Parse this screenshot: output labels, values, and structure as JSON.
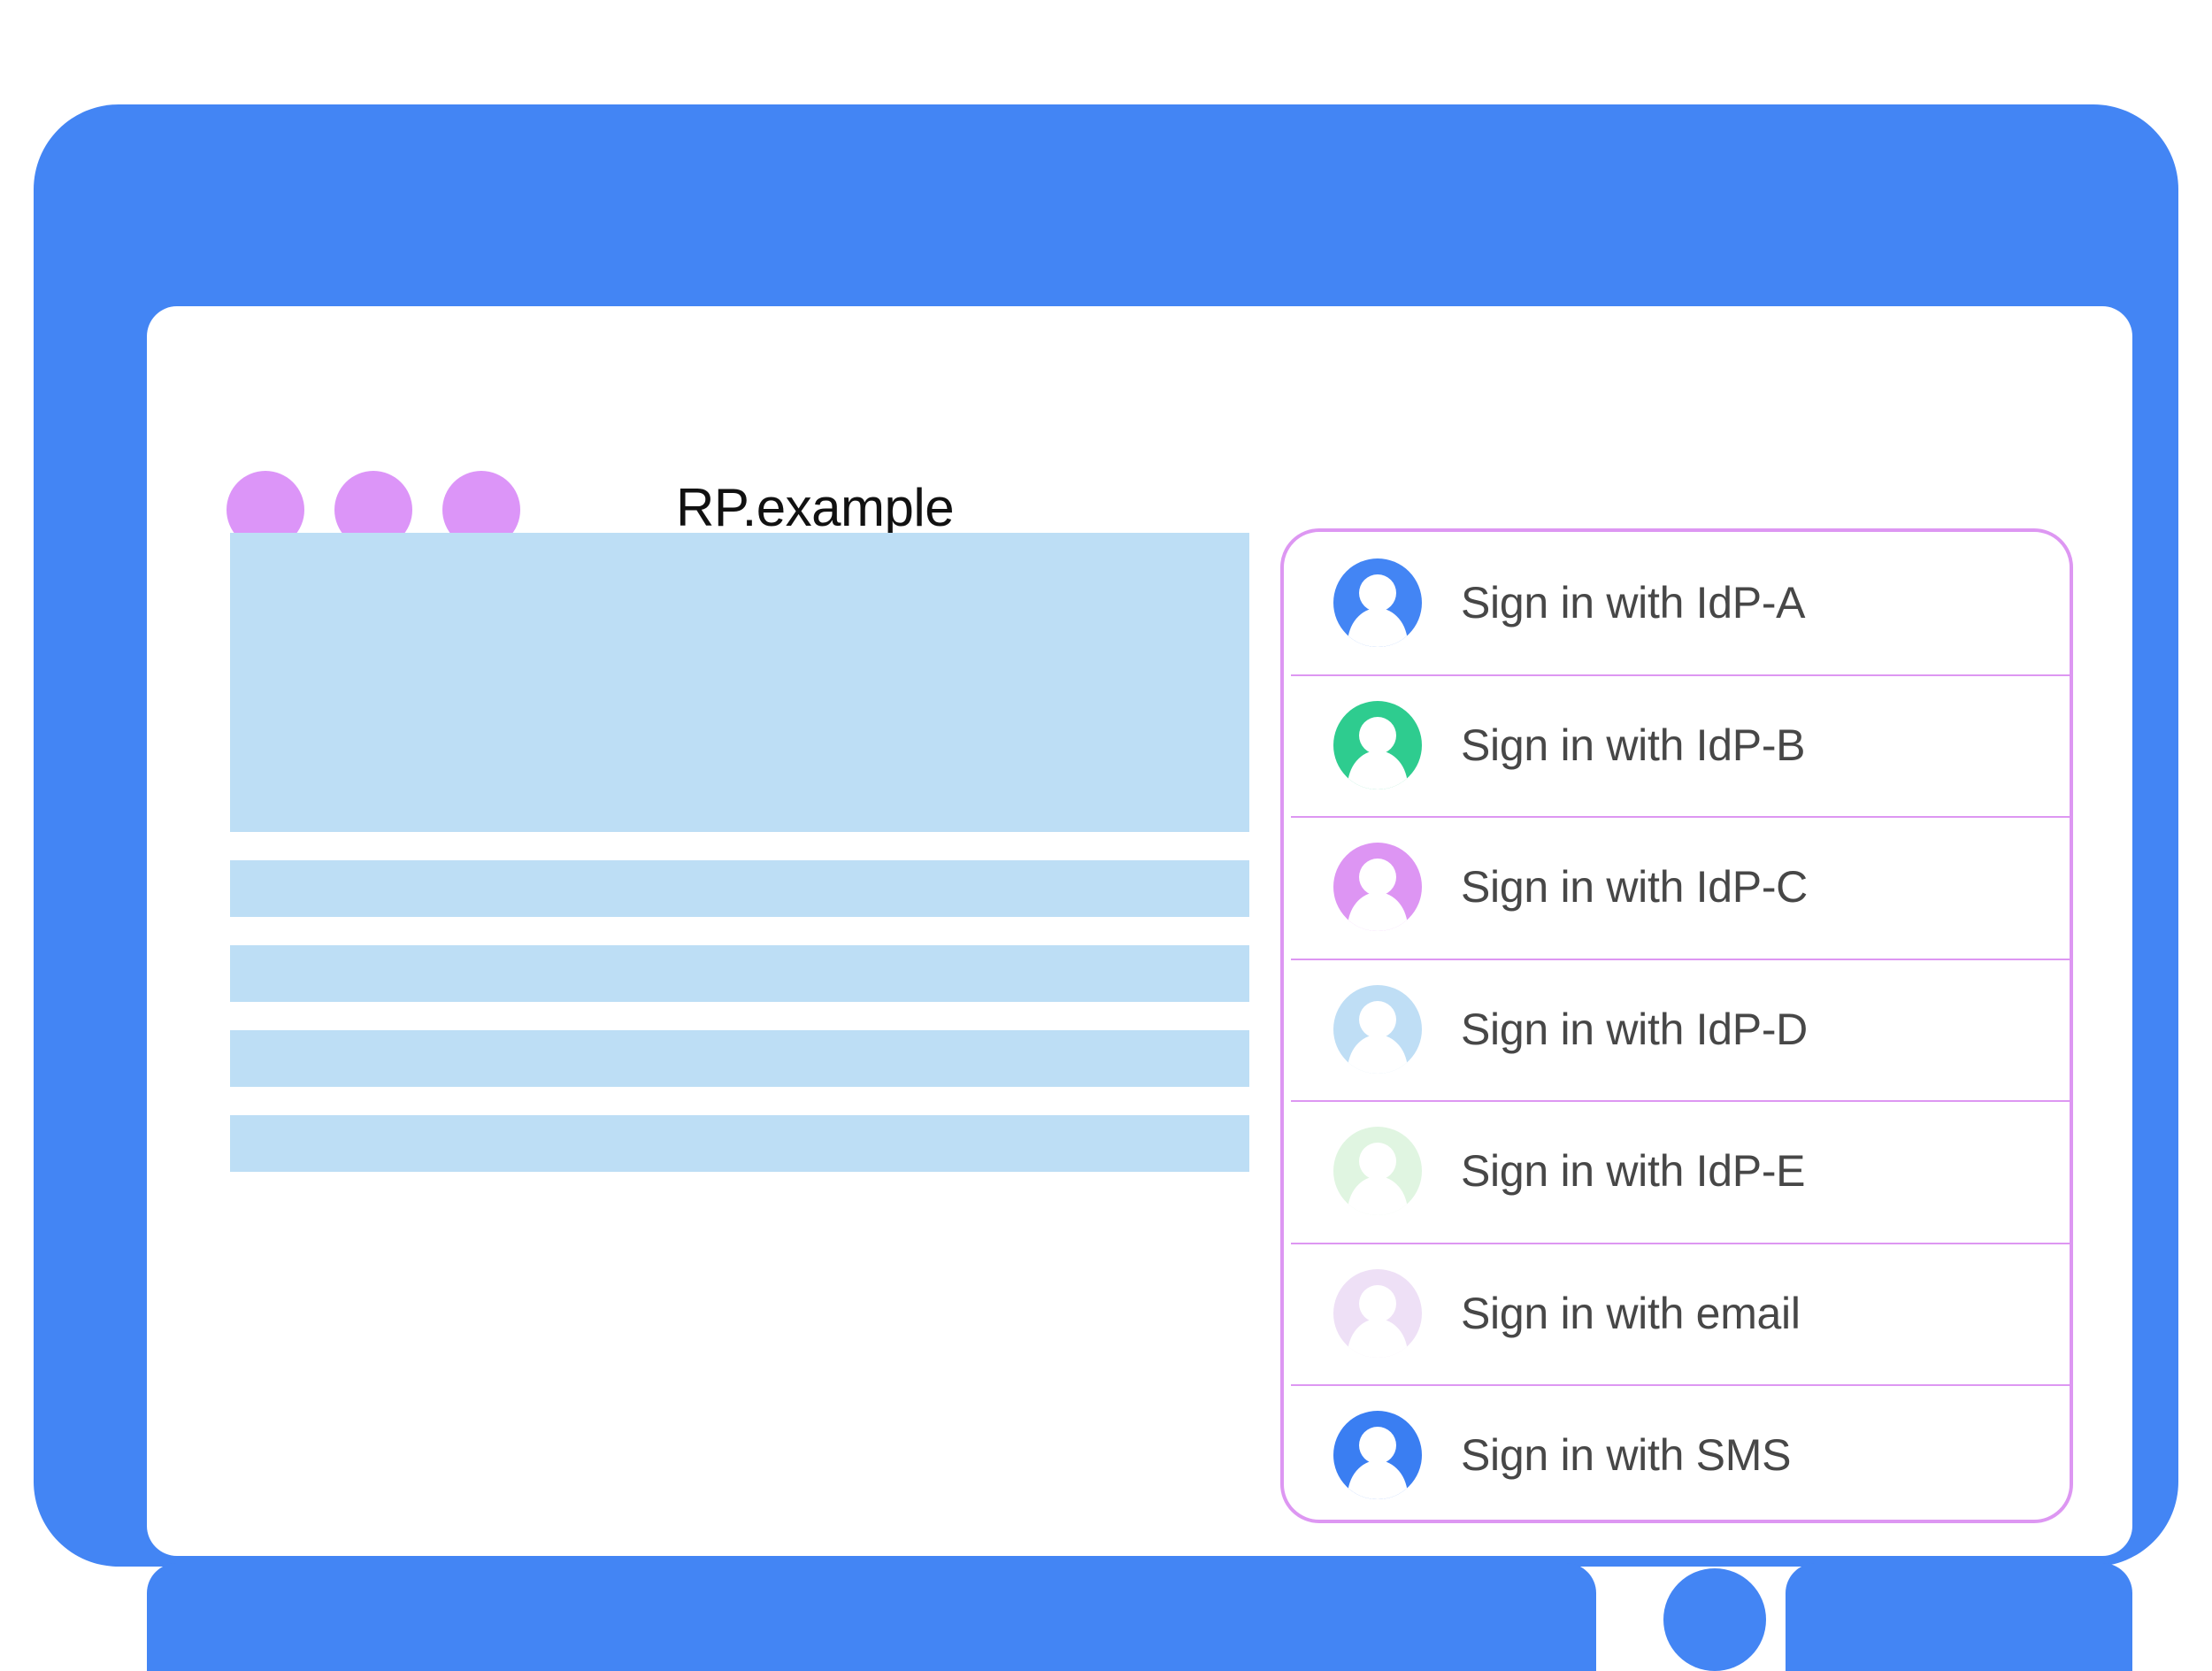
{
  "window": {
    "title": "RP.example",
    "traffic_dots": [
      "dot-purple-1",
      "dot-purple-2",
      "dot-purple-3"
    ],
    "frame_color": "#4385f4",
    "dot_color": "#dc95f8",
    "screen_background": "#ffffff",
    "home_button": "home-button"
  },
  "content": {
    "placeholder_color": "#bddef5",
    "blocks": [
      {
        "kind": "hero"
      },
      {
        "kind": "bar"
      },
      {
        "kind": "bar"
      },
      {
        "kind": "bar"
      },
      {
        "kind": "bar"
      }
    ]
  },
  "signin_panel": {
    "border_color": "#dd97f2",
    "divider_color": "#dd97f2",
    "label_color": "#474747",
    "items": [
      {
        "label": "Sign in with IdP-A",
        "icon": "avatar-icon",
        "avatar_color": "#4385f4"
      },
      {
        "label": "Sign in with IdP-B",
        "icon": "avatar-icon",
        "avatar_color": "#2ecc8f"
      },
      {
        "label": "Sign in with IdP-C",
        "icon": "avatar-icon",
        "avatar_color": "#dd95f3"
      },
      {
        "label": "Sign in with IdP-D",
        "icon": "avatar-icon",
        "avatar_color": "#bfdef5"
      },
      {
        "label": "Sign in with IdP-E",
        "icon": "avatar-icon",
        "avatar_color": "#e0f5e1"
      },
      {
        "label": "Sign in with email",
        "icon": "avatar-icon",
        "avatar_color": "#eee0f6"
      },
      {
        "label": "Sign in with SMS",
        "icon": "avatar-icon",
        "avatar_color": "#3a7ef2"
      }
    ]
  }
}
